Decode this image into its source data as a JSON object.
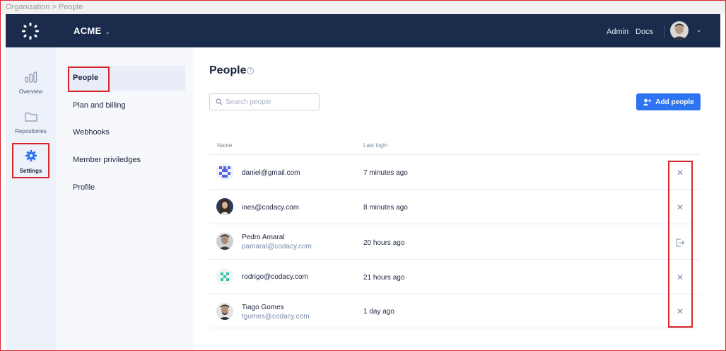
{
  "breadcrumb": "Organization > People",
  "topbar": {
    "org_name": "ACME",
    "links": [
      "Admin",
      "Docs"
    ]
  },
  "leftnav": [
    {
      "label": "Overview",
      "icon": "bar-chart-icon"
    },
    {
      "label": "Repositories",
      "icon": "folder-icon"
    },
    {
      "label": "Settings",
      "icon": "gear-icon",
      "active": true
    }
  ],
  "subnav": [
    {
      "label": "People",
      "active": true
    },
    {
      "label": "Plan and billing"
    },
    {
      "label": "Webhooks"
    },
    {
      "label": "Member priviledges"
    },
    {
      "label": "Profile"
    }
  ],
  "main": {
    "title": "People",
    "search_placeholder": "Search people",
    "add_button": "Add people",
    "columns": {
      "name": "Name",
      "last_login": "Last login"
    }
  },
  "people": [
    {
      "name": "daniel@gmail.com",
      "email": "",
      "last_login": "7 minutes ago",
      "action": "remove",
      "avatar": "identicon-blue"
    },
    {
      "name": "ines@codacy.com",
      "email": "",
      "last_login": "8 minutes ago",
      "action": "remove",
      "avatar": "photo"
    },
    {
      "name": "Pedro Amaral",
      "email": "pamaral@codacy.com",
      "last_login": "20 hours ago",
      "action": "leave",
      "avatar": "photo"
    },
    {
      "name": "rodrigo@codacy.com",
      "email": "",
      "last_login": "21 hours ago",
      "action": "remove",
      "avatar": "identicon-teal"
    },
    {
      "name": "Tiago Gomes",
      "email": "tgomes@codacy.com",
      "last_login": "1 day ago",
      "action": "remove",
      "avatar": "photo"
    }
  ],
  "colors": {
    "topbar": "#1a2b4c",
    "accent": "#2c74f2",
    "highlight_box": "#d9262c"
  }
}
